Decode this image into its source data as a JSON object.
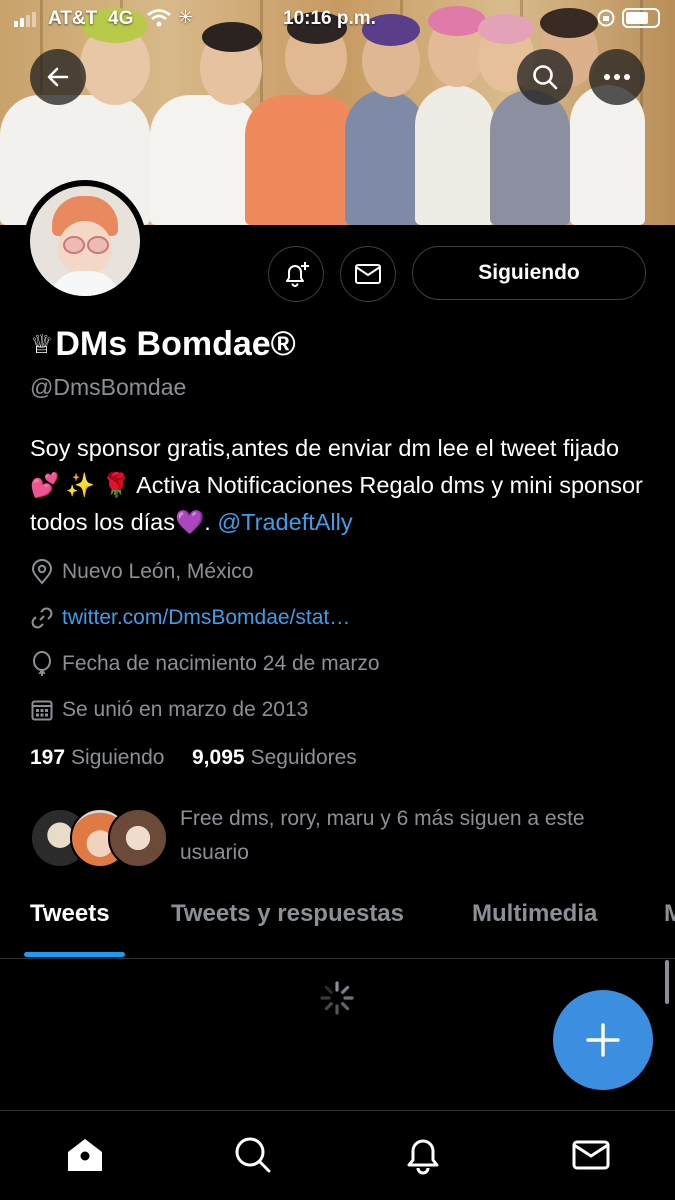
{
  "status_bar": {
    "carrier": "AT&T",
    "network": "4G",
    "time": "10:16 p.m."
  },
  "profile": {
    "display_name": "DMs Bomdae®",
    "crown": "♕",
    "handle": "@DmsBomdae",
    "bio_text": "Soy sponsor gratis,antes de enviar dm lee el tweet fijado 💕 ✨ 🌹 Activa Notificaciones Regalo dms y mini sponsor todos los días💜.",
    "bio_mention": "@TradeftAlly",
    "location": "Nuevo León, México",
    "website": "twitter.com/DmsBomdae/stat…",
    "birthday": "Fecha de nacimiento 24 de marzo",
    "joined": "Se unió en marzo de 2013",
    "following_count": "197",
    "following_label": "Siguiendo",
    "followers_count": "9,095",
    "followers_label": "Seguidores",
    "followed_by_text": "Free dms, rory, maru y 6 más siguen a este usuario"
  },
  "actions": {
    "follow_button": "Siguiendo"
  },
  "tabs": [
    {
      "label": "Tweets",
      "active": true
    },
    {
      "label": "Tweets y respuestas",
      "active": false
    },
    {
      "label": "Multimedia",
      "active": false
    },
    {
      "label": "M",
      "active": false
    }
  ],
  "colors": {
    "accent": "#1d9bf0",
    "link": "#3f9ee8",
    "background": "#000000",
    "muted": "#8b9096"
  },
  "bottom_nav": [
    "home-icon",
    "search-icon",
    "notifications-icon",
    "messages-icon"
  ]
}
